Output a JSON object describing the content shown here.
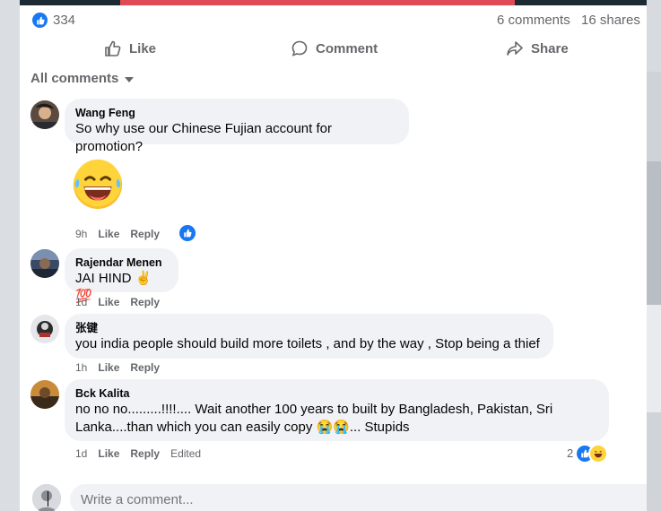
{
  "post": {
    "like_count": "334",
    "comments_count": "6 comments",
    "shares_count": "16 shares"
  },
  "actions": {
    "like": "Like",
    "comment": "Comment",
    "share": "Share"
  },
  "filter": {
    "label": "All comments"
  },
  "comments": [
    {
      "author": "Wang Feng",
      "text": "So why use our Chinese Fujian account for promotion?",
      "time": "9h",
      "like": "Like",
      "reply": "Reply"
    },
    {
      "author": "Rajendar Menen",
      "text": "JAI HIND ✌ 💯",
      "time": "1d",
      "like": "Like",
      "reply": "Reply"
    },
    {
      "author": "张键",
      "text": "you india people should build more toilets , and by the way , Stop being a thief",
      "time": "1h",
      "like": "Like",
      "reply": "Reply"
    },
    {
      "author": "Bck Kalita",
      "text_line1": "no no no.........!!!!.... Wait another 100 years to built by Bangladesh, Pakistan, Sri",
      "text_line2": "Lanka....than which you can easily copy 😭😭... Stupids",
      "time": "1d",
      "like": "Like",
      "reply": "Reply",
      "edited": "Edited",
      "reaction_count": "2"
    }
  ],
  "composer": {
    "placeholder": "Write a comment..."
  },
  "colors": {
    "accent": "#1877f2",
    "bubble": "#f0f2f5",
    "muted": "#65676b"
  }
}
